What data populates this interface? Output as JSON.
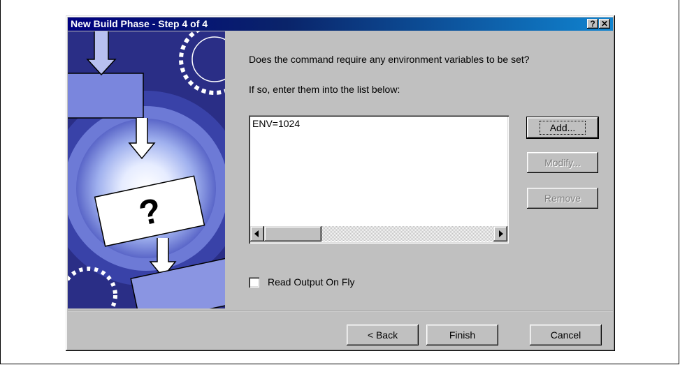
{
  "dialog": {
    "title": "New Build Phase - Step 4 of 4",
    "help_label": "?",
    "close_label": "✕"
  },
  "main": {
    "question": "Does the command require any environment variables to be set?",
    "instruction": "If so, enter them into the list below:",
    "env_list": [
      "ENV=1024"
    ],
    "checkbox_label": "Read Output On Fly",
    "checkbox_checked": false
  },
  "side_buttons": {
    "add": "Add...",
    "modify": "Modify...",
    "remove": "Remove"
  },
  "footer_buttons": {
    "back": "< Back",
    "finish": "Finish",
    "cancel": "Cancel"
  },
  "colors": {
    "titlebar_start": "#000080",
    "titlebar_end": "#1084d0",
    "dialog_face": "#c0c0c0",
    "art_background": "#2a2e86",
    "art_glow": "#b9c4f2"
  }
}
